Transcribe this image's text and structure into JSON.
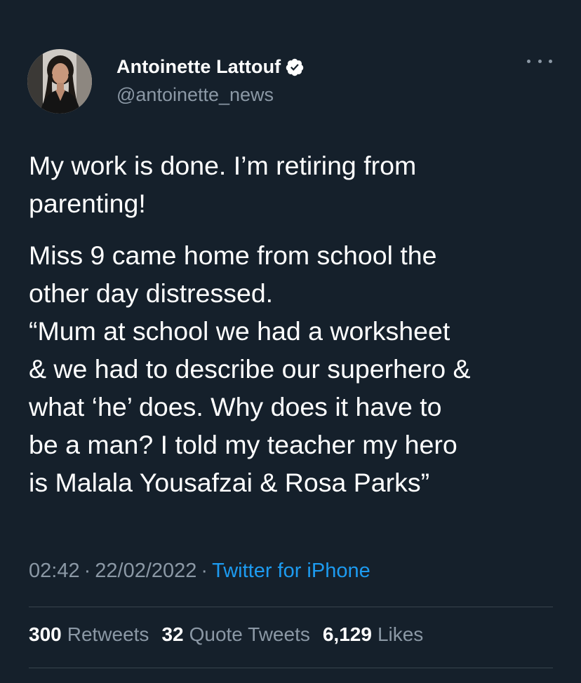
{
  "author": {
    "display_name": "Antoinette Lattouf",
    "handle": "@antoinette_news",
    "verified_icon": "verified-badge-icon"
  },
  "menu": {
    "icon": "more-horizontal-icon"
  },
  "tweet": {
    "paragraphs": [
      [
        "My work is done. I’m retiring from",
        "parenting!"
      ],
      [
        "Miss 9 came home from school the",
        "other day distressed.",
        "“Mum at school we had a worksheet",
        "& we had to describe our superhero &",
        "what ‘he’ does. Why does it have to",
        "be a man? I told my teacher my hero",
        "is Malala Yousafzai & Rosa Parks”"
      ]
    ],
    "time": "02:42",
    "date": "22/02/2022",
    "separator": "·",
    "client": "Twitter for iPhone"
  },
  "stats": {
    "retweets_count": "300",
    "retweets_label": "Retweets",
    "quotes_count": "32",
    "quotes_label": "Quote Tweets",
    "likes_count": "6,129",
    "likes_label": "Likes"
  },
  "colors": {
    "background": "#15202b",
    "text": "#ffffff",
    "secondary": "#8b98a5",
    "accent": "#1d9bf0",
    "divider": "#38444d"
  }
}
